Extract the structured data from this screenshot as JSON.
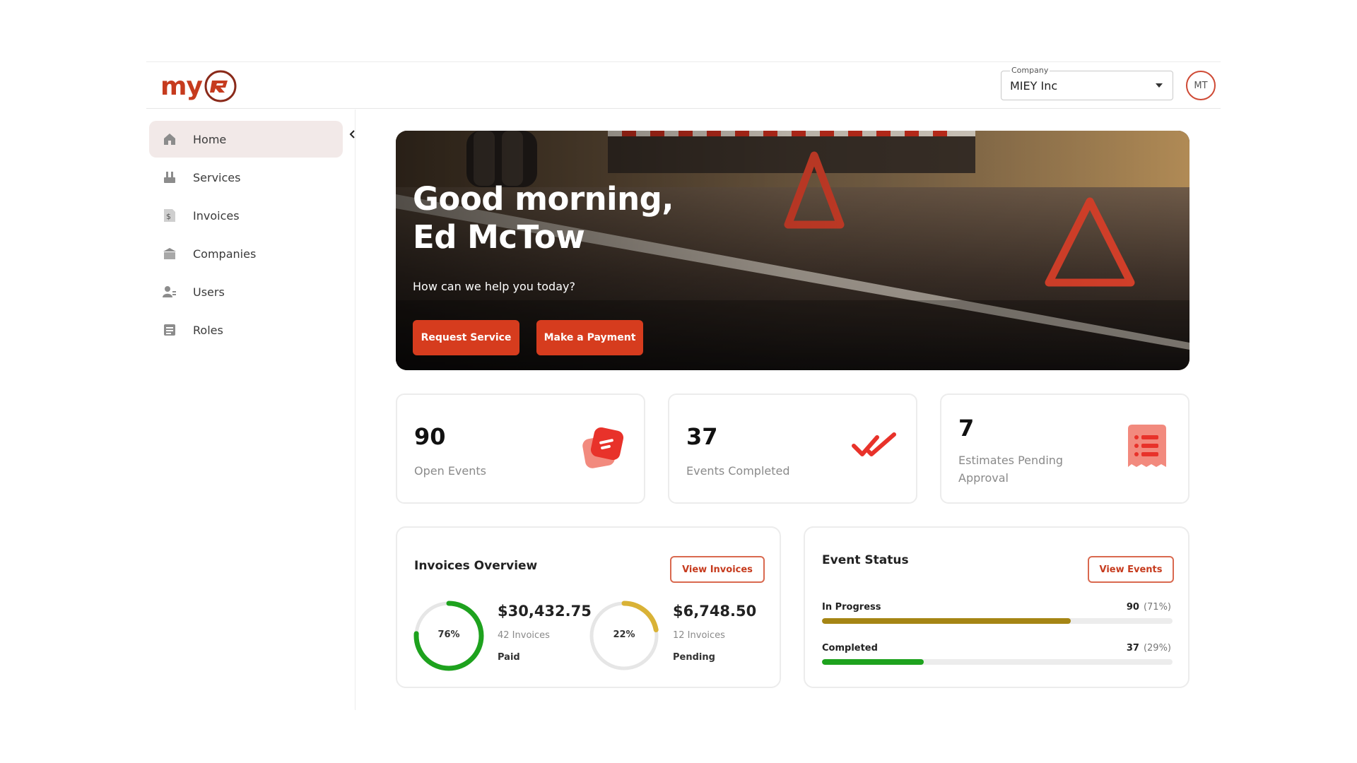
{
  "brand": {
    "logo_text": "my",
    "accent_color": "#d63c1e"
  },
  "header": {
    "company_label": "Company",
    "company_value": "MIEY Inc",
    "avatar_initials": "MT"
  },
  "sidebar": {
    "items": [
      {
        "label": "Home",
        "icon": "home-icon",
        "active": true
      },
      {
        "label": "Services",
        "icon": "services-icon",
        "active": false
      },
      {
        "label": "Invoices",
        "icon": "invoice-icon",
        "active": false
      },
      {
        "label": "Companies",
        "icon": "companies-icon",
        "active": false
      },
      {
        "label": "Users",
        "icon": "users-icon",
        "active": false
      },
      {
        "label": "Roles",
        "icon": "roles-icon",
        "active": false
      }
    ]
  },
  "hero": {
    "greeting_line1": "Good morning,",
    "greeting_line2": "Ed McTow",
    "subtitle": "How can we help you today?",
    "request_service_label": "Request Service",
    "make_payment_label": "Make a Payment"
  },
  "stats": [
    {
      "value": "90",
      "label": "Open Events",
      "icon": "events-icon"
    },
    {
      "value": "37",
      "label": "Events Completed",
      "icon": "double-check-icon"
    },
    {
      "value": "7",
      "label": "Estimates Pending Approval",
      "icon": "receipt-list-icon"
    }
  ],
  "invoices_overview": {
    "title": "Invoices Overview",
    "button_label": "View Invoices",
    "paid": {
      "percent": 76,
      "percent_label": "76%",
      "amount": "$30,432.75",
      "count": "42 Invoices",
      "status": "Paid",
      "color": "#1ea21e"
    },
    "pending": {
      "percent": 22,
      "percent_label": "22%",
      "amount": "$6,748.50",
      "count": "12 Invoices",
      "status": "Pending",
      "color": "#d9b236"
    }
  },
  "event_status": {
    "title": "Event Status",
    "button_label": "View Events",
    "rows": [
      {
        "label": "In Progress",
        "count": "90",
        "pct_label": "(71%)",
        "fraction": 0.71,
        "color": "#a58514"
      },
      {
        "label": "Completed",
        "count": "37",
        "pct_label": "(29%)",
        "fraction": 0.29,
        "color": "#1ea21e"
      }
    ]
  }
}
